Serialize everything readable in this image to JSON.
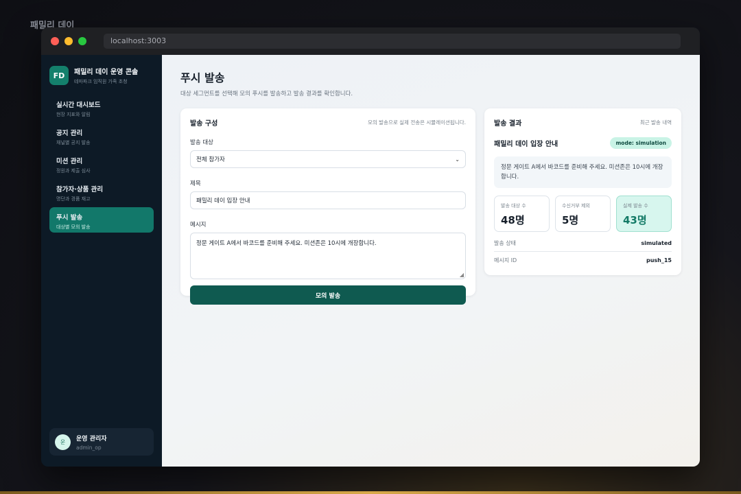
{
  "desktop": {
    "title": "패밀리 데이"
  },
  "browser": {
    "url": "localhost:3003"
  },
  "sidebar": {
    "brand_logo": "FD",
    "brand_title": "패밀리 데이 운영 콘솔",
    "brand_sub": "테마파크 임직원 가족 초청",
    "items": [
      {
        "label": "실시간 대시보드",
        "sub": "현장 지표와 알림"
      },
      {
        "label": "공지 관리",
        "sub": "채널별 공지 발송"
      },
      {
        "label": "미션 관리",
        "sub": "정원과 제출 심사"
      },
      {
        "label": "참가자·상품 관리",
        "sub": "명단과 경품 재고"
      },
      {
        "label": "푸시 발송",
        "sub": "대상별 모의 발송",
        "active": true
      }
    ],
    "user": {
      "avatar": "운",
      "name": "운영 관리자",
      "id": "admin_op"
    }
  },
  "page": {
    "title": "푸시 발송",
    "description": "대상 세그먼트를 선택해 모의 푸시를 발송하고 발송 결과를 확인합니다."
  },
  "compose": {
    "title": "발송 구성",
    "note": "모의 발송으로 실제 전송은 시뮬레이션됩니다.",
    "target_label": "발송 대상",
    "target_value": "전체 참가자",
    "subject_label": "제목",
    "subject_value": "패밀리 데이 입장 안내",
    "message_label": "메시지",
    "message_value": "정문 게이트 A에서 바코드를 준비해 주세요. 미션존은 10시에 개장합니다.",
    "send_button": "모의 발송"
  },
  "result": {
    "title": "발송 결과",
    "note": "최근 발송 내역",
    "message_title": "패밀리 데이 입장 안내",
    "mode_badge": "mode: simulation",
    "message_body": "정문 게이트 A에서 바코드를 준비해 주세요. 미션존은 10시에 개장합니다.",
    "stats": [
      {
        "label": "발송 대상 수",
        "value": "48명"
      },
      {
        "label": "수신거부 제외",
        "value": "5명"
      },
      {
        "label": "실제 발송 수",
        "value": "43명"
      }
    ],
    "status_label": "발송 상태",
    "status_value": "simulated",
    "message_id_label": "메시지 ID",
    "message_id_value": "push_15"
  },
  "colors": {
    "accent": "#12786a",
    "button": "#0f5a50",
    "badge": "#c9f3e6"
  }
}
